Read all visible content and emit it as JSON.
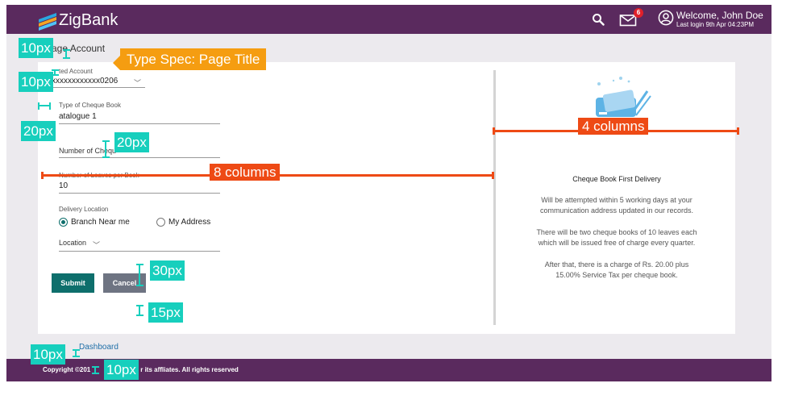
{
  "header": {
    "brand": "ZigBank",
    "mail_badge": "6",
    "welcome": "Welcome, John Doe",
    "last_login": "Last login 9th Apr 04:23PM"
  },
  "page": {
    "title": "age Account"
  },
  "form": {
    "selected_account_label": "ted Account",
    "selected_account_value": "xxxxxxxxxxxx0206",
    "cheque_type_label": "Type of Cheque Book",
    "cheque_type_value": "atalogue 1",
    "num_cheque_placeholder": "Number of Chequ",
    "leaves_label": "Number of Leaves per Book",
    "leaves_value": "10",
    "delivery_label": "Delivery Location",
    "option_branch": "Branch Near me",
    "option_address": "My Address",
    "location_placeholder": "Location",
    "submit_label": "Submit",
    "cancel_label": "Cancel"
  },
  "info": {
    "title": "Cheque Book First Delivery",
    "p1a": "Will be attempted within 5 working days at your",
    "p1b": "communication address updated in our records.",
    "p2a": "There will be two cheque books of 10 leaves each",
    "p2b": "which will be issued free of charge every quarter.",
    "p3a": "After that, there is a charge of Rs. 20.00 plus",
    "p3b": "15.00% Service Tax per cheque book."
  },
  "links": {
    "dashboard": "Dashboard"
  },
  "footer": {
    "copyright_left": "Copyright ©201",
    "copyright_right": "r its affliates. All rights reserved"
  },
  "annotations": {
    "page_title_spec": "Type Spec: Page Title",
    "px10": "10px",
    "px20": "20px",
    "px30": "30px",
    "px15": "15px",
    "cols8": "8 columns",
    "cols4": "4 columns"
  },
  "colors": {
    "brand_purple": "#5a2a5e",
    "primary_teal": "#0e6f6c",
    "annotation_cyan": "#17cfbd",
    "annotation_orange": "#f59d11",
    "annotation_red": "#ee4a15"
  }
}
